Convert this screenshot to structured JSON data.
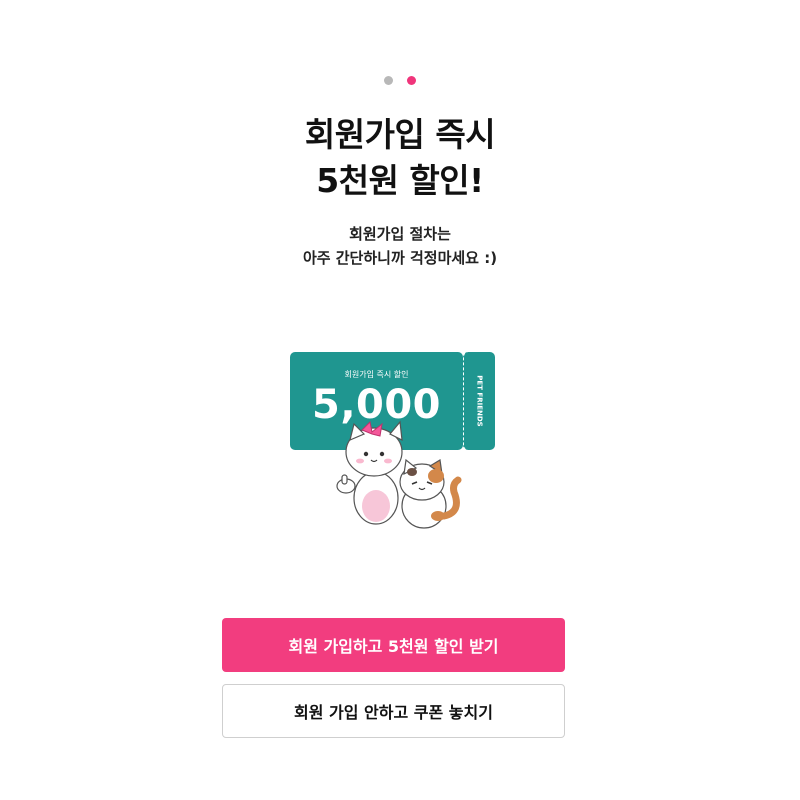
{
  "pager": {
    "total": 2,
    "active_index": 1,
    "inactive_color": "#b8b8b8",
    "active_color": "#f0357b"
  },
  "headline": {
    "line1": "회원가입 즉시",
    "line2": "5천원 할인!"
  },
  "subtext": {
    "line1": "회원가입 절차는",
    "line2": "아주 간단하니까 걱정마세요 :)"
  },
  "coupon": {
    "caption": "회원가입 즉시 할인",
    "amount": "5,000",
    "brand": "PET FRIENDS",
    "color": "#1f9690"
  },
  "buttons": {
    "signup": "회원 가입하고 5천원 할인 받기",
    "skip": "회원 가입 안하고 쿠폰 놓치기"
  },
  "colors": {
    "accent": "#f23d7f"
  }
}
